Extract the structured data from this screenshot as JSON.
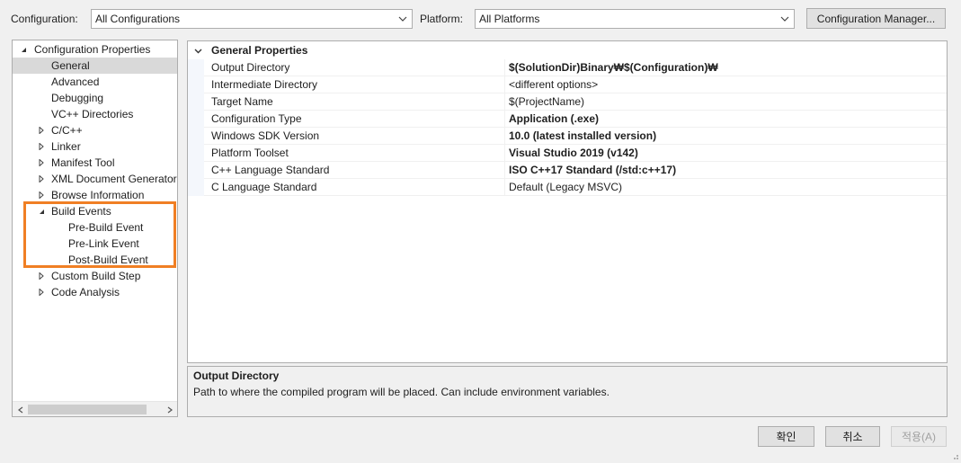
{
  "toolbar": {
    "configuration_label": "Configuration:",
    "configuration_value": "All Configurations",
    "platform_label": "Platform:",
    "platform_value": "All Platforms",
    "config_manager_label": "Configuration Manager..."
  },
  "tree": {
    "root": "Configuration Properties",
    "items": [
      "General",
      "Advanced",
      "Debugging",
      "VC++ Directories",
      "C/C++",
      "Linker",
      "Manifest Tool",
      "XML Document Generator",
      "Browse Information",
      "Build Events",
      "Pre-Build Event",
      "Pre-Link Event",
      "Post-Build Event",
      "Custom Build Step",
      "Code Analysis"
    ]
  },
  "grid": {
    "category": "General Properties",
    "rows": [
      {
        "name": "Output Directory",
        "value": "$(SolutionDir)Binary₩$(Configuration)₩"
      },
      {
        "name": "Intermediate Directory",
        "value": "<different options>"
      },
      {
        "name": "Target Name",
        "value": "$(ProjectName)"
      },
      {
        "name": "Configuration Type",
        "value": "Application (.exe)"
      },
      {
        "name": "Windows SDK Version",
        "value": "10.0 (latest installed version)"
      },
      {
        "name": "Platform Toolset",
        "value": "Visual Studio 2019 (v142)"
      },
      {
        "name": "C++ Language Standard",
        "value": "ISO C++17 Standard (/std:c++17)"
      },
      {
        "name": "C Language Standard",
        "value": "Default (Legacy MSVC)"
      }
    ]
  },
  "description": {
    "title": "Output Directory",
    "text": "Path to where the compiled program will be placed. Can include environment variables."
  },
  "buttons": {
    "ok": "확인",
    "cancel": "취소",
    "apply": "적용(A)"
  },
  "colors": {
    "highlight_box": "#f07f24",
    "selected_bg": "#d9d9d9"
  }
}
